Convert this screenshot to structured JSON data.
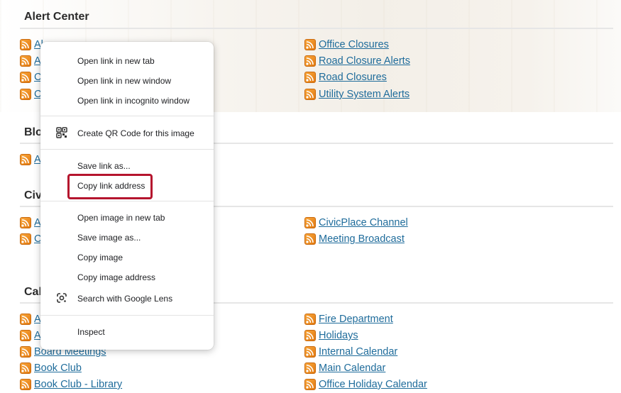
{
  "sections": {
    "alert_center": "Alert Center",
    "blog": "Blo",
    "civic": "Civ",
    "calendar": "Cal"
  },
  "left_feeds": [
    "Al",
    "A",
    "C",
    "C",
    "A",
    "A",
    "C",
    "A",
    "A",
    "Board Meetings",
    "Book Club",
    "Book Club - Library"
  ],
  "right_feeds": {
    "office_closures": "Office Closures",
    "road_closure_alerts": "Road Closure Alerts",
    "road_closures": "Road Closures",
    "utility_system_alerts": "Utility System Alerts",
    "civicplace_channel": "CivicPlace Channel",
    "meeting_broadcast": "Meeting Broadcast",
    "fire_department": "Fire Department",
    "holidays": "Holidays",
    "internal_calendar": "Internal Calendar",
    "main_calendar": "Main Calendar",
    "office_holiday_calendar": "Office Holiday Calendar"
  },
  "context_menu": {
    "open_new_tab": "Open link in new tab",
    "open_new_window": "Open link in new window",
    "open_incognito": "Open link in incognito window",
    "qr_code": "Create QR Code for this image",
    "save_link": "Save link as...",
    "copy_link": "Copy link address",
    "open_image_tab": "Open image in new tab",
    "save_image": "Save image as...",
    "copy_image": "Copy image",
    "copy_image_address": "Copy image address",
    "google_lens": "Search with Google Lens",
    "inspect": "Inspect"
  },
  "icons": {
    "feed": "rss-feed-icon",
    "qr": "qr-code-icon",
    "lens": "google-lens-icon"
  },
  "colors": {
    "link": "#1f6c9b",
    "highlight": "#b5152e",
    "rss": "#f08a1c"
  }
}
